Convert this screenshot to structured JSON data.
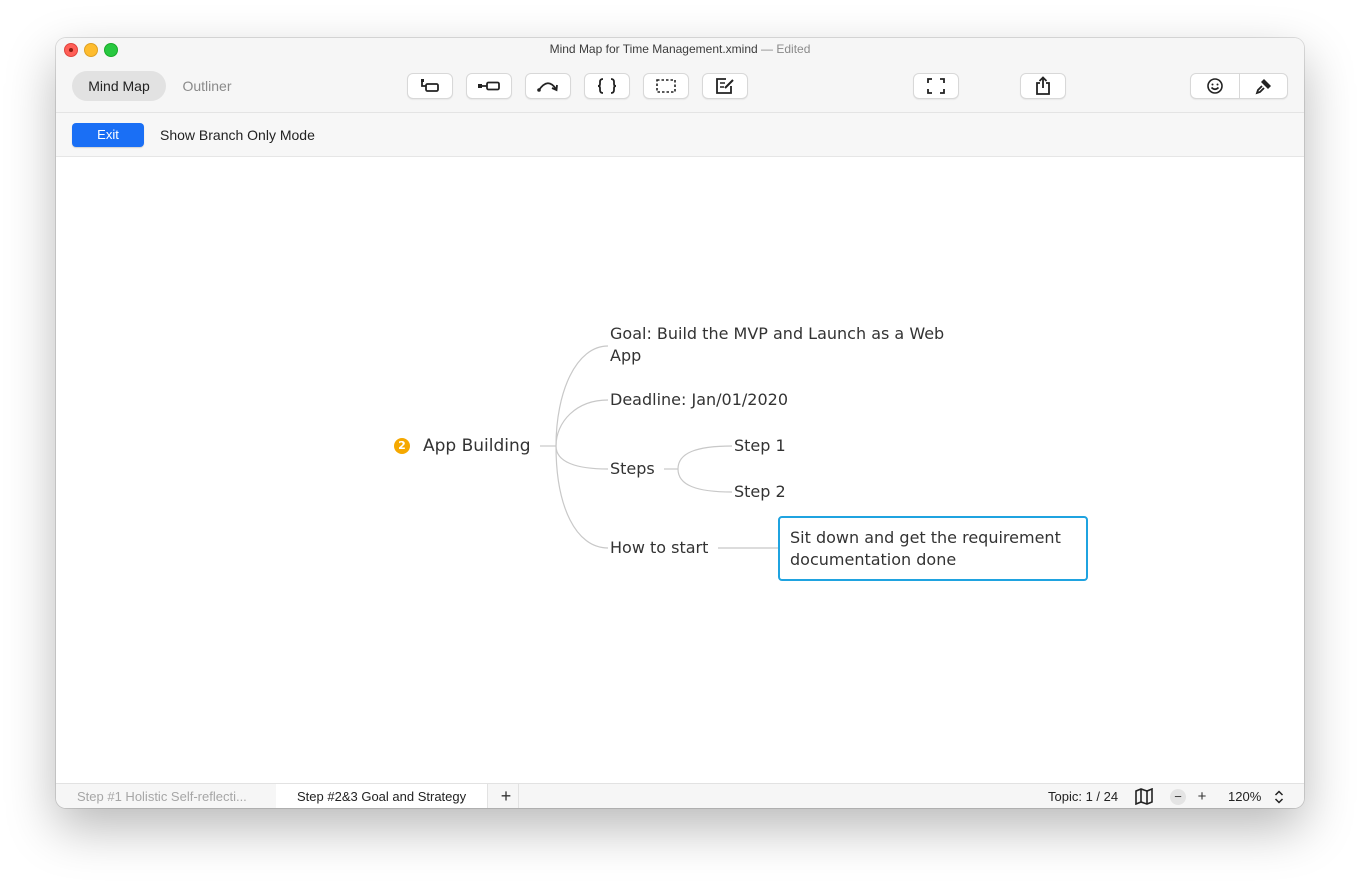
{
  "window": {
    "title": "Mind Map for Time Management.xmind",
    "status": "— Edited"
  },
  "toolbar": {
    "view_modes": [
      "Mind Map",
      "Outliner"
    ],
    "active_view": "Mind Map",
    "buttons": [
      "topic-icon",
      "subtopic-icon",
      "relationship-icon",
      "boundary-icon",
      "summary-icon",
      "note-icon",
      "zen-mode-icon",
      "share-icon",
      "sticker-icon",
      "format-icon"
    ]
  },
  "branch_mode": {
    "exit_label": "Exit",
    "label": "Show Branch Only Mode"
  },
  "mindmap": {
    "root": {
      "badge": "2",
      "label": "App Building",
      "badge_color": "#f5a800"
    },
    "branches": [
      {
        "label": "Goal: Build the MVP and Launch as a Web App"
      },
      {
        "label": "Deadline: Jan/01/2020"
      },
      {
        "label": "Steps",
        "children": [
          {
            "label": "Step 1"
          },
          {
            "label": "Step 2"
          }
        ]
      },
      {
        "label": "How to start",
        "children": [
          {
            "label": "Sit down and get the requirement documentation done",
            "selected": true
          }
        ]
      }
    ],
    "selection_color": "#1fa3e0"
  },
  "statusbar": {
    "sheets": [
      "Step #1 Holistic Self-reflecti...",
      "Step #2&3 Goal and Strategy"
    ],
    "active_sheet": "Step #2&3 Goal and Strategy",
    "add_sheet": "+",
    "topic_count": "Topic: 1 / 24",
    "zoom_out": "−",
    "zoom_in": "+",
    "zoom": "120%"
  },
  "colors": {
    "accent": "#1a6ff5"
  }
}
